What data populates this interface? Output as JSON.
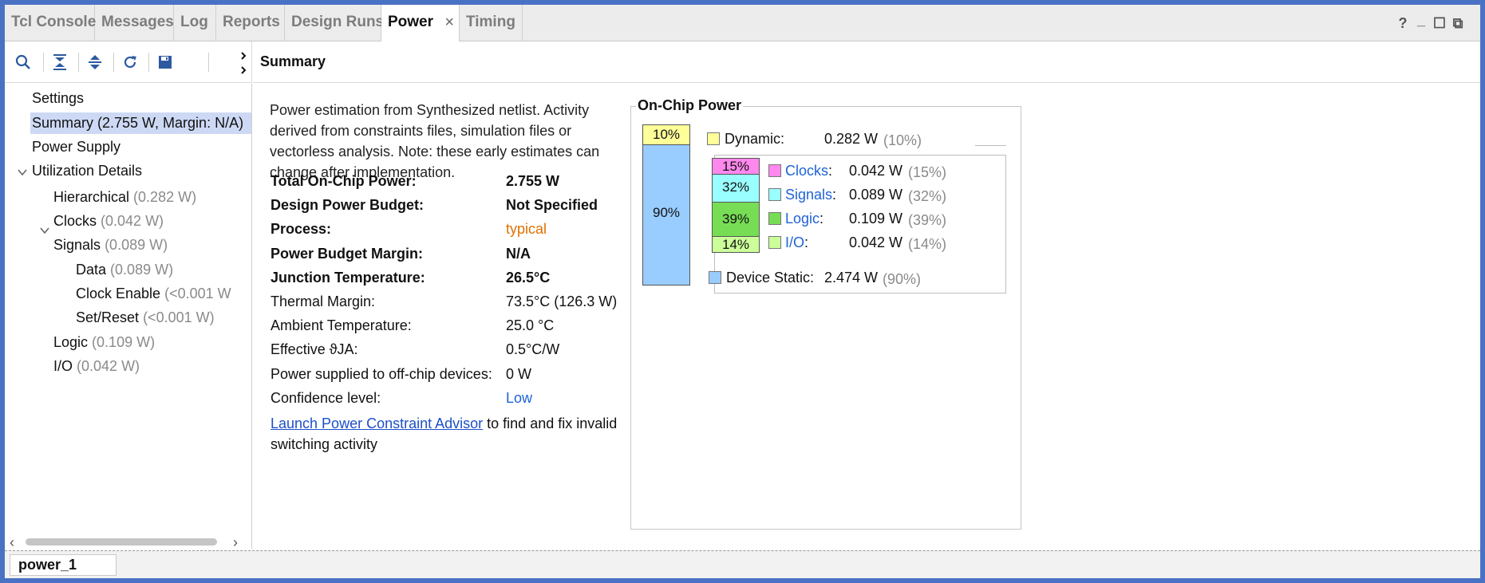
{
  "tabs": [
    {
      "label": "Tcl Console"
    },
    {
      "label": "Messages"
    },
    {
      "label": "Log"
    },
    {
      "label": "Reports"
    },
    {
      "label": "Design Runs"
    },
    {
      "label": "Power",
      "active": true,
      "close": "×"
    },
    {
      "label": "Timing"
    }
  ],
  "window_controls": {
    "help": "?",
    "minimize": "_",
    "maximize": "☐",
    "float": "⧉"
  },
  "toolbar": {
    "icons": [
      "search-icon",
      "collapse-all-icon",
      "expand-all-icon",
      "refresh-icon",
      "save-icon"
    ]
  },
  "summary_header": "Summary",
  "tree": {
    "items": [
      {
        "label": "Settings",
        "value": ""
      },
      {
        "label": "Summary (2.755 W, Margin: N/A)",
        "value": "",
        "selected": true
      },
      {
        "label": "Power Supply",
        "value": ""
      },
      {
        "label": "Utilization Details",
        "value": "",
        "expanded": true
      },
      {
        "label": "Hierarchical",
        "value": "(0.282 W)"
      },
      {
        "label": "Clocks",
        "value": "(0.042 W)"
      },
      {
        "label": "Signals",
        "value": "(0.089 W)",
        "expanded": true
      },
      {
        "label": "Data",
        "value": "(0.089 W)"
      },
      {
        "label": "Clock Enable",
        "value": "(<0.001 W"
      },
      {
        "label": "Set/Reset",
        "value": "(<0.001 W)"
      },
      {
        "label": "Logic",
        "value": "(0.109 W)"
      },
      {
        "label": "I/O",
        "value": "(0.042 W)"
      }
    ]
  },
  "description": "Power estimation from Synthesized netlist. Activity derived from constraints files, simulation files or vectorless analysis. Note: these early estimates can change after implementation.",
  "properties": [
    {
      "label": "Total On-Chip Power:",
      "value": "2.755 W",
      "bold": true
    },
    {
      "label": "Design Power Budget:",
      "value": "Not Specified",
      "bold": true
    },
    {
      "label": "Process:",
      "value": "typical",
      "bold": true,
      "style": "orange"
    },
    {
      "label": "Power Budget Margin:",
      "value": "N/A",
      "bold": true
    },
    {
      "label": "Junction Temperature:",
      "value": "26.5°C",
      "bold": true
    },
    {
      "label": "Thermal Margin:",
      "value": "73.5°C (126.3 W)"
    },
    {
      "label": "Ambient Temperature:",
      "value": "25.0 °C"
    },
    {
      "label": "Effective ϑJA:",
      "value": "0.5°C/W"
    },
    {
      "label": "Power supplied to off-chip devices:",
      "value": "0 W"
    },
    {
      "label": "Confidence level:",
      "value": "Low",
      "style": "blue"
    }
  ],
  "advisor": {
    "link": "Launch Power Constraint Advisor",
    "text": " to find and fix invalid switching activity"
  },
  "on_chip_power": {
    "title": "On-Chip Power",
    "main_bar": [
      {
        "label": "10%",
        "percent": 10,
        "color": "#ffff99"
      },
      {
        "label": "90%",
        "percent": 90,
        "color": "#99ccff"
      }
    ],
    "dynamic": {
      "label": "Dynamic:",
      "value": "0.282 W",
      "percent": "(10%)",
      "color": "#ffff99"
    },
    "dynamic_bar": [
      {
        "label": "15%",
        "percent": 15,
        "color": "#ff88ee"
      },
      {
        "label": "32%",
        "percent": 32,
        "color": "#99ffff"
      },
      {
        "label": "39%",
        "percent": 39,
        "color": "#77dd55"
      },
      {
        "label": "14%",
        "percent": 14,
        "color": "#ccff99"
      }
    ],
    "breakdown": [
      {
        "label": "Clocks",
        "value": "0.042 W",
        "percent": "(15%)",
        "color": "#ff88ee"
      },
      {
        "label": "Signals",
        "value": "0.089 W",
        "percent": "(32%)",
        "color": "#99ffff"
      },
      {
        "label": "Logic",
        "value": "0.109 W",
        "percent": "(39%)",
        "color": "#77dd55"
      },
      {
        "label": "I/O",
        "value": "0.042 W",
        "percent": "(14%)",
        "color": "#ccff99"
      }
    ],
    "static": {
      "label": "Device Static:",
      "value": "2.474 W",
      "percent": "(90%)",
      "color": "#99ccff"
    }
  },
  "bottom_tab": "power_1"
}
